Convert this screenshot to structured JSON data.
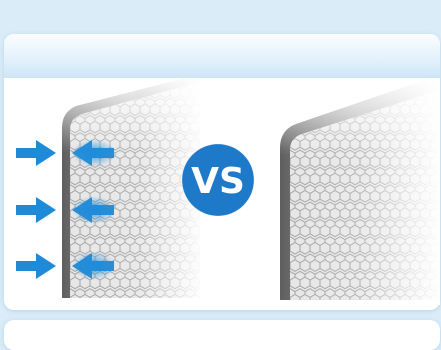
{
  "comparison": {
    "badge_text": "VS"
  },
  "colors": {
    "page_background": "#d9ecf8",
    "accent_blue": "#1f8ad8",
    "badge_blue": "#1e79c8",
    "filter_frame": "#7a7a7a",
    "honeycomb_fill": "#d8d8d8"
  },
  "icons": {
    "left_panel": [
      "arrow-right-icon",
      "arrow-left-icon"
    ],
    "arrow_rows": 3
  }
}
